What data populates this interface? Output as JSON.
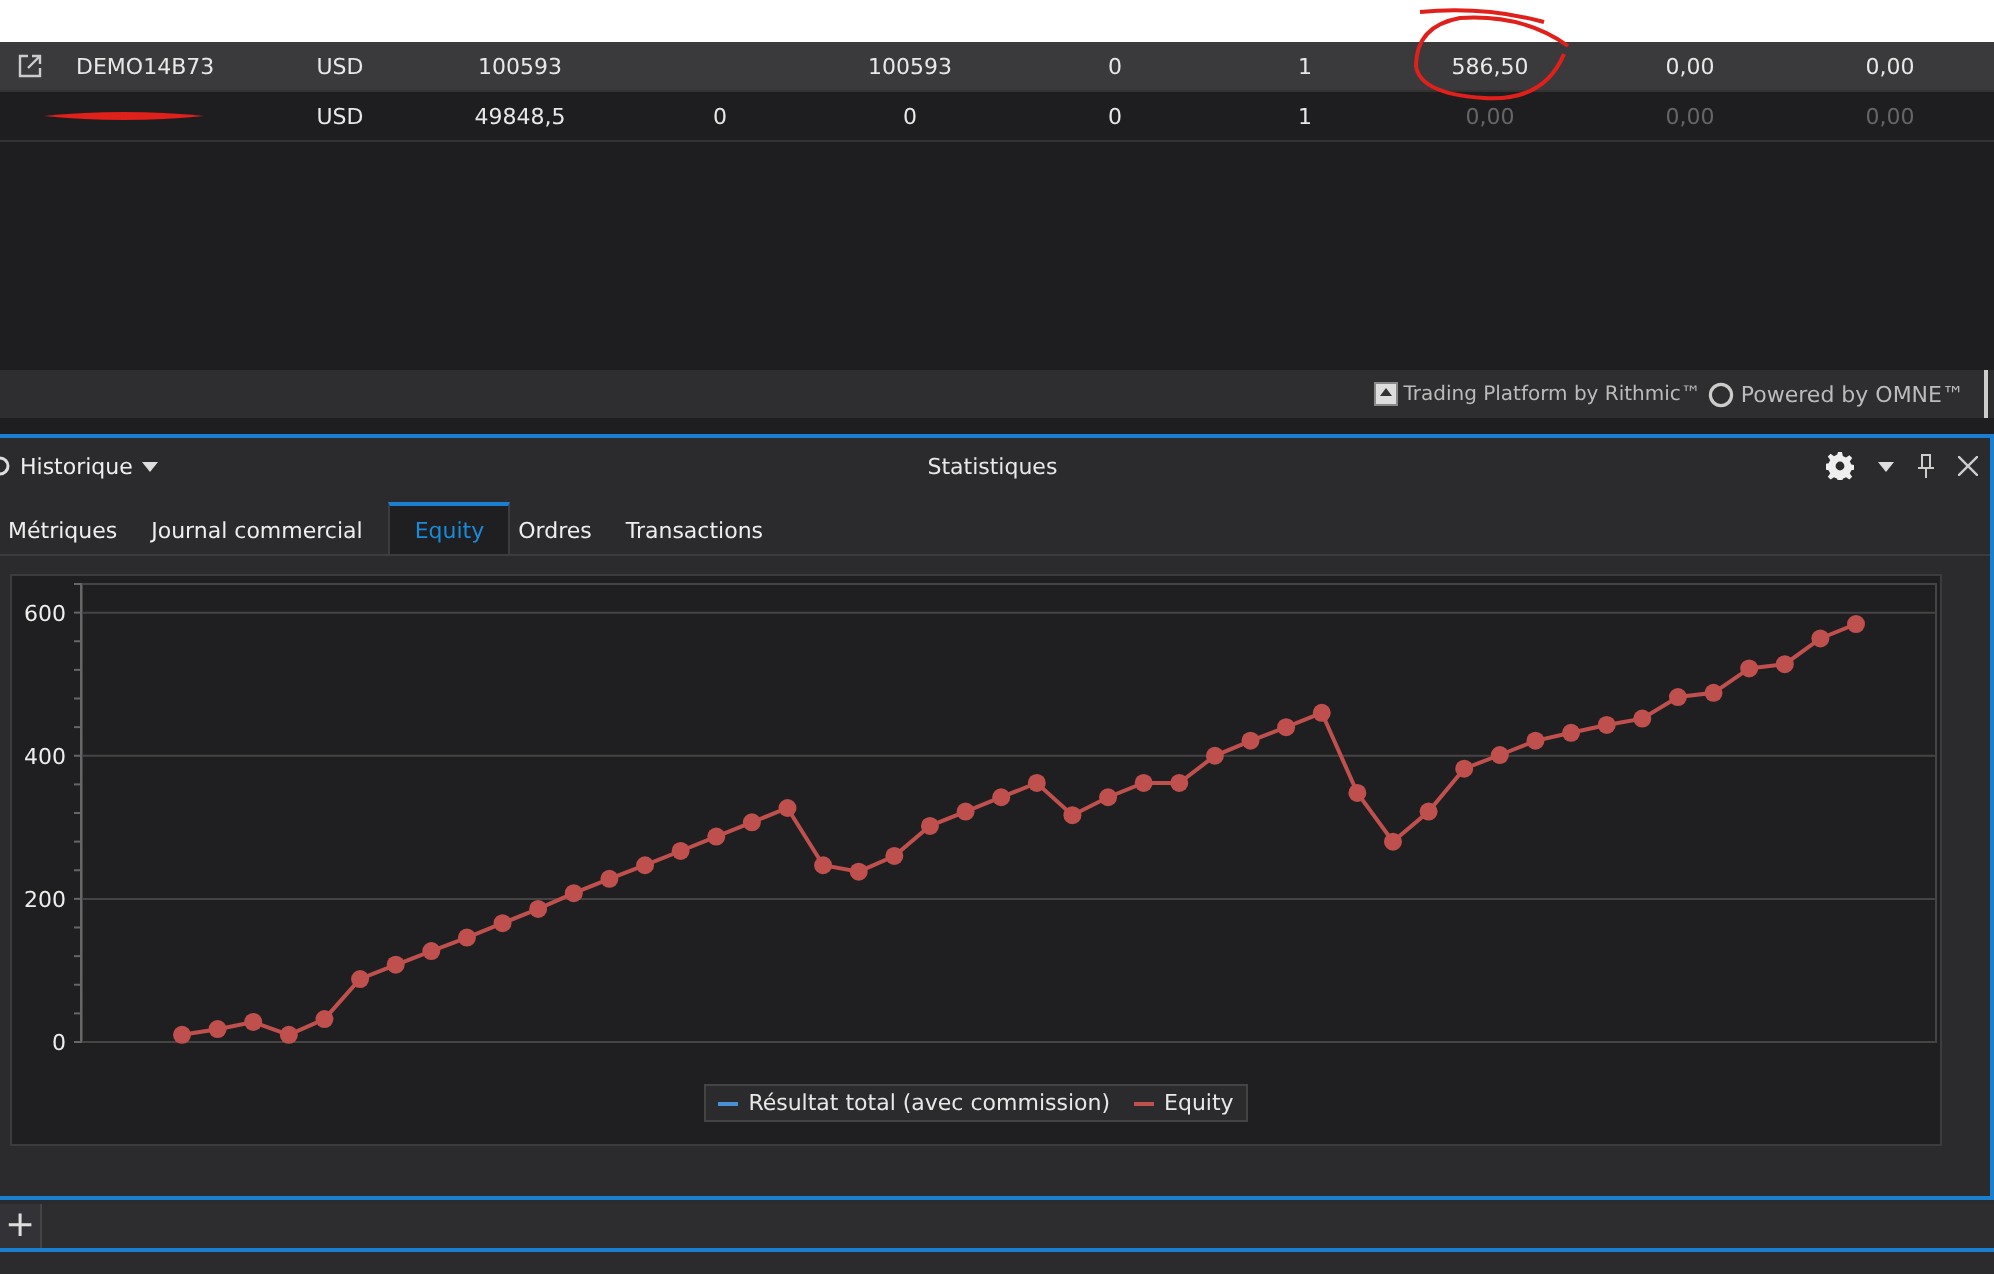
{
  "accounts": {
    "rows": [
      {
        "selected": true,
        "link_icon": true,
        "redacted": false,
        "name": "DEMO14B73",
        "cells": [
          {
            "text": "USD",
            "dimmed": false,
            "circled": false
          },
          {
            "text": "100593",
            "dimmed": false,
            "circled": false
          },
          null,
          {
            "text": "100593",
            "dimmed": false,
            "circled": false
          },
          {
            "text": "0",
            "dimmed": false,
            "circled": false
          },
          {
            "text": "1",
            "dimmed": false,
            "circled": false
          },
          {
            "text": "586,50",
            "dimmed": false,
            "circled": true
          },
          {
            "text": "0,00",
            "dimmed": false,
            "circled": false
          },
          {
            "text": "0,00",
            "dimmed": false,
            "circled": false
          }
        ]
      },
      {
        "selected": false,
        "link_icon": false,
        "redacted": true,
        "cells": [
          {
            "text": "USD",
            "dimmed": false,
            "circled": false
          },
          {
            "text": "49848,5",
            "dimmed": false,
            "circled": false
          },
          {
            "text": "0",
            "dimmed": false,
            "circled": false
          },
          {
            "text": "0",
            "dimmed": false,
            "circled": false
          },
          {
            "text": "0",
            "dimmed": false,
            "circled": false
          },
          {
            "text": "1",
            "dimmed": false,
            "circled": false
          },
          {
            "text": "0,00",
            "dimmed": true,
            "circled": false
          },
          {
            "text": "0,00",
            "dimmed": true,
            "circled": false
          },
          {
            "text": "0,00",
            "dimmed": true,
            "circled": false
          }
        ]
      }
    ]
  },
  "branding": {
    "platform": "Trading Platform by Rithmic™",
    "powered": "Powered by OMNE™"
  },
  "panel": {
    "menu": "Historique",
    "title": "Statistiques",
    "tabs": [
      {
        "label": "Métriques",
        "selected": false
      },
      {
        "label": "Journal commercial",
        "selected": false
      },
      {
        "label": "Equity",
        "selected": true
      },
      {
        "label": "Ordres",
        "selected": false
      },
      {
        "label": "Transactions",
        "selected": false
      }
    ],
    "chart_data": {
      "type": "line",
      "grid": true,
      "ylim": [
        0,
        640
      ],
      "yticks": [
        {
          "value": 0,
          "label": "0"
        },
        {
          "value": 200,
          "label": "200"
        },
        {
          "value": 400,
          "label": "400"
        },
        {
          "value": 600,
          "label": "600"
        }
      ],
      "categories": [
        null,
        null,
        null,
        null,
        null,
        null,
        null,
        null,
        null,
        null,
        null,
        null,
        null,
        null,
        null,
        null,
        null,
        null,
        null,
        null,
        null,
        null,
        null,
        null,
        null,
        null,
        null,
        null,
        null,
        null,
        null,
        null,
        null,
        null,
        null,
        null,
        null,
        null,
        null,
        null,
        null,
        null,
        null,
        null,
        null,
        null,
        null,
        null
      ],
      "series": [
        {
          "name": "Résultat total (avec commission)",
          "color": "#4a90d9",
          "values": [
            null,
            null,
            null,
            null,
            null,
            null,
            null,
            null,
            null,
            null,
            null,
            null,
            null,
            null,
            null,
            null,
            null,
            null,
            null,
            null,
            null,
            null,
            null,
            null,
            null,
            null,
            null,
            null,
            null,
            null,
            null,
            null,
            null,
            null,
            null,
            null,
            null,
            null,
            null,
            null,
            null,
            null,
            null,
            null,
            null,
            null,
            null,
            null
          ]
        },
        {
          "name": "Equity",
          "color": "#c0504d",
          "marker": "circle",
          "values": [
            10,
            18,
            28,
            10,
            32,
            88,
            108,
            127,
            146,
            166,
            186,
            208,
            228,
            247,
            267,
            287,
            307,
            327,
            247,
            238,
            260,
            302,
            322,
            342,
            362,
            317,
            342,
            362,
            362,
            400,
            421,
            440,
            460,
            348,
            280,
            322,
            382,
            401,
            421,
            432,
            443,
            452,
            482,
            488,
            522,
            528,
            564,
            584
          ]
        }
      ]
    }
  },
  "footer": {
    "add_button": "+"
  }
}
